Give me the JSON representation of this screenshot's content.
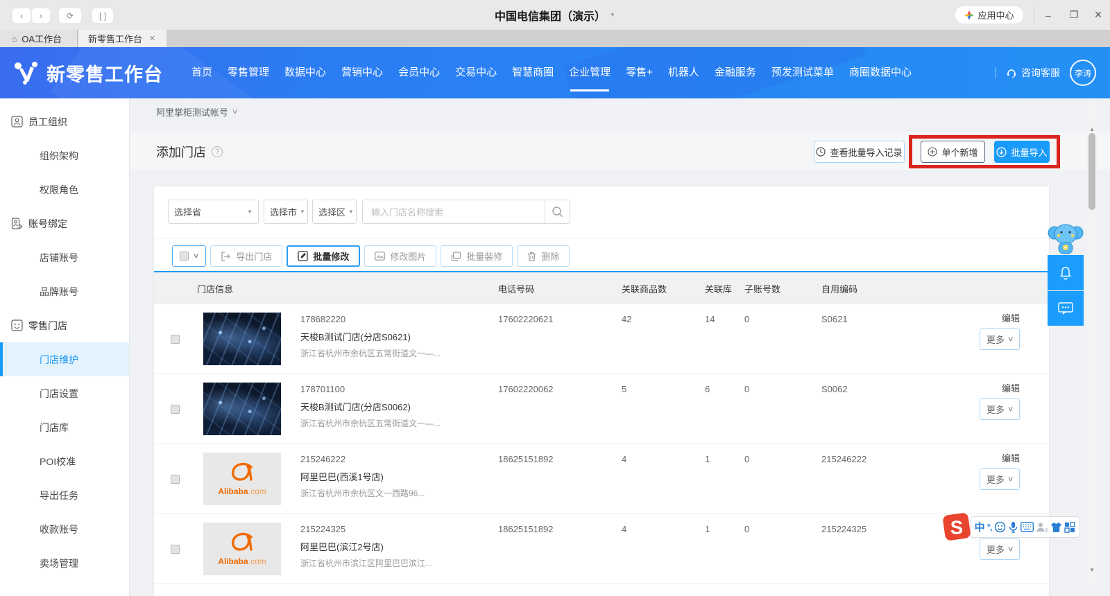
{
  "chrome": {
    "title": "中国电信集团（演示）",
    "app_center": "应用中心"
  },
  "tabs": {
    "home": "OA工作台",
    "active": "新零售工作台"
  },
  "topnav": {
    "brand": "新零售工作台",
    "items": [
      {
        "label": "首页"
      },
      {
        "label": "零售管理"
      },
      {
        "label": "数据中心"
      },
      {
        "label": "营销中心"
      },
      {
        "label": "会员中心"
      },
      {
        "label": "交易中心"
      },
      {
        "label": "智慧商圈"
      },
      {
        "label": "企业管理",
        "active": true
      },
      {
        "label": "零售+"
      },
      {
        "label": "机器人"
      },
      {
        "label": "金融服务"
      },
      {
        "label": "预发测试菜单"
      },
      {
        "label": "商圈数据中心"
      }
    ],
    "support": "咨询客服",
    "user": "李涛"
  },
  "sidebar": {
    "items": [
      {
        "type": "group",
        "label": "员工组织",
        "icon": "org-icon"
      },
      {
        "type": "child",
        "label": "组织架构"
      },
      {
        "type": "child",
        "label": "权限角色"
      },
      {
        "type": "group",
        "label": "账号绑定",
        "icon": "bind-icon"
      },
      {
        "type": "child",
        "label": "店铺账号"
      },
      {
        "type": "child",
        "label": "品牌账号"
      },
      {
        "type": "group",
        "label": "零售门店",
        "icon": "store-icon"
      },
      {
        "type": "child",
        "label": "门店维护",
        "selected": true
      },
      {
        "type": "child",
        "label": "门店设置"
      },
      {
        "type": "child",
        "label": "门店库"
      },
      {
        "type": "child",
        "label": "POI校准"
      },
      {
        "type": "child",
        "label": "导出任务"
      },
      {
        "type": "child",
        "label": "收款账号"
      },
      {
        "type": "child",
        "label": "卖场管理"
      }
    ]
  },
  "content": {
    "breadcrumb": "阿里掌柜测试帐号",
    "title": "添加门店",
    "buttons": {
      "record": "查看批量导入记录",
      "add": "单个新增",
      "import": "批量导入"
    },
    "filters": {
      "province": "选择省",
      "city": "选择市",
      "district": "选择区",
      "search_placeholder": "输入门店名称搜索"
    },
    "toolbar": [
      {
        "label": "导出门店",
        "icon": "export-icon"
      },
      {
        "label": "批量修改",
        "icon": "edit-icon",
        "emphasized": true
      },
      {
        "label": "修改图片",
        "icon": "image-icon"
      },
      {
        "label": "批量装修",
        "icon": "decorate-icon"
      },
      {
        "label": "删除",
        "icon": "trash-icon"
      }
    ],
    "table": {
      "columns": [
        "门店信息",
        "电话号码",
        "关联商品数",
        "关联库",
        "子账号数",
        "自用编码"
      ],
      "rows": [
        {
          "thumb": "world-map",
          "id": "178682220",
          "name": "天梭B测试门店(分店S0621)",
          "address": "浙江省杭州市余杭区五常街道文一—...",
          "phone": "17602220621",
          "goods": "42",
          "lib": "14",
          "sub": "0",
          "code": "S0621",
          "edit": "编辑",
          "more": "更多"
        },
        {
          "thumb": "world-map",
          "id": "178701100",
          "name": "天梭B测试门店(分店S0062)",
          "address": "浙江省杭州市余杭区五常街道文一—...",
          "phone": "17602220062",
          "goods": "5",
          "lib": "6",
          "sub": "0",
          "code": "S0062",
          "edit": "编辑",
          "more": "更多"
        },
        {
          "thumb": "alibaba",
          "id": "215246222",
          "name": "阿里巴巴(西溪1号店)",
          "address": "浙江省杭州市余杭区文一西路96...",
          "phone": "18625151892",
          "goods": "4",
          "lib": "1",
          "sub": "0",
          "code": "215246222",
          "edit": "编辑",
          "more": "更多"
        },
        {
          "thumb": "alibaba",
          "id": "215224325",
          "name": "阿里巴巴(滨江2号店)",
          "address": "浙江省杭州市滨江区阿里巴巴滨江...",
          "phone": "18625151892",
          "goods": "4",
          "lib": "1",
          "sub": "0",
          "code": "215224325",
          "edit": "编辑",
          "more": "更多"
        }
      ],
      "alibaba_logo": {
        "main": "Alibaba",
        "suffix": ".com"
      }
    }
  },
  "ime": {
    "mode": "中",
    "punct": "°,"
  },
  "colors": {
    "accent": "#199bfa",
    "nav_blue": "#2b7df3",
    "annotation_red": "#d9251c",
    "primary_btn": "#199bfa"
  }
}
